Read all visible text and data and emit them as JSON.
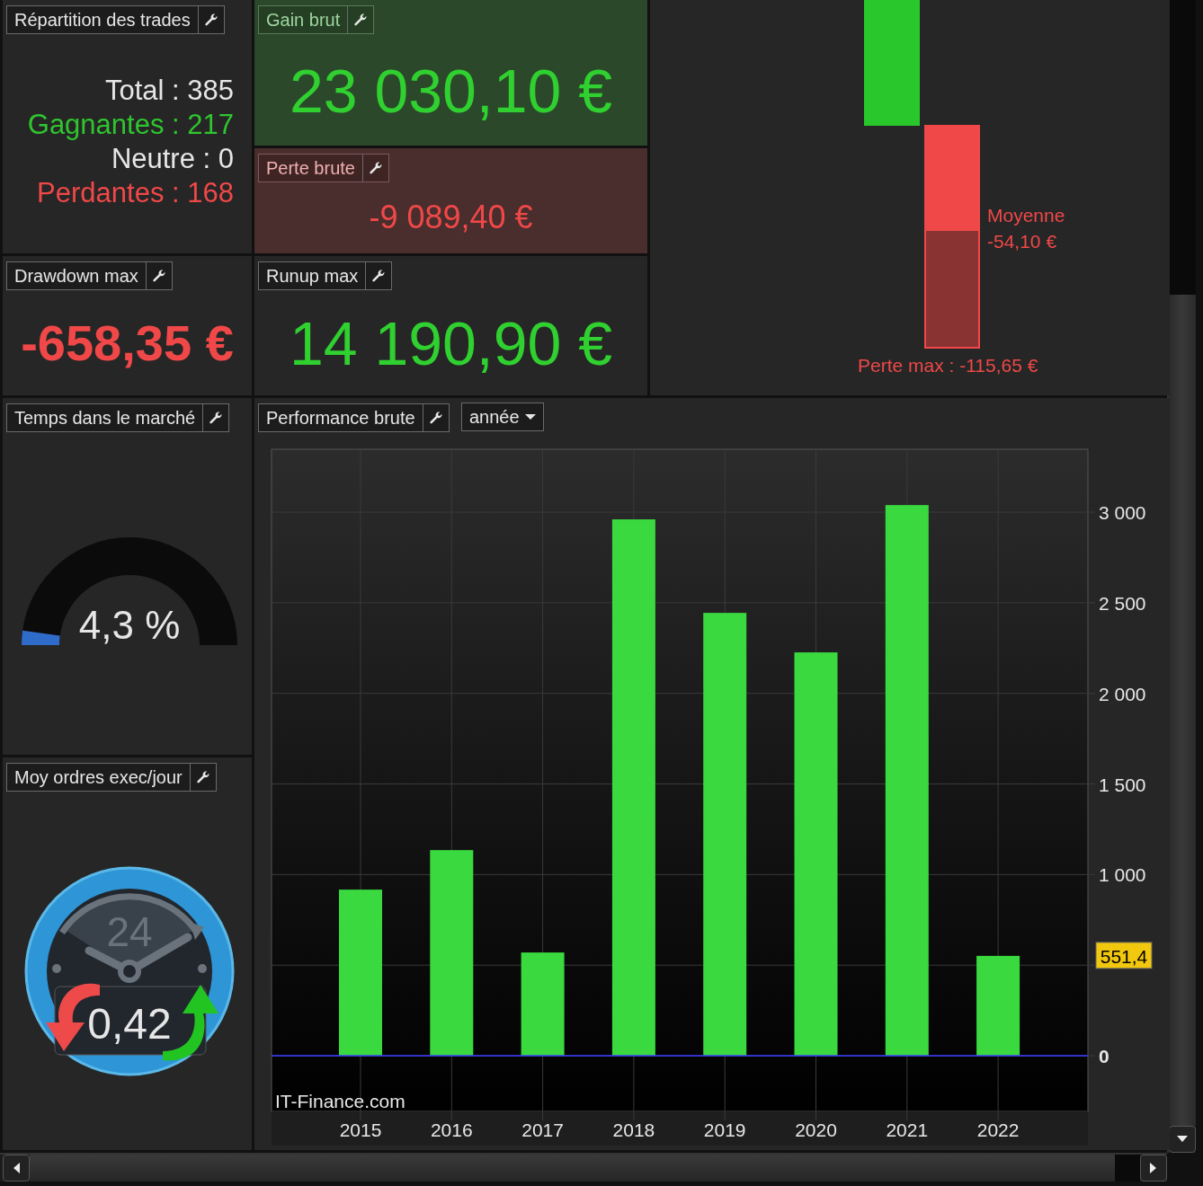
{
  "repartition": {
    "title": "Répartition des trades",
    "lines": [
      {
        "kind": "total",
        "text": "Total : 385"
      },
      {
        "kind": "win",
        "text": "Gagnantes : 217"
      },
      {
        "kind": "neutral",
        "text": "Neutre : 0"
      },
      {
        "kind": "loss",
        "text": "Perdantes : 168"
      }
    ]
  },
  "gain_brut": {
    "title": "Gain brut",
    "value": "23 030,10 €"
  },
  "perte_brute": {
    "title": "Perte brute",
    "value": "-9 089,40 €"
  },
  "drawdown_max": {
    "title": "Drawdown max",
    "value": "-658,35 €"
  },
  "runup_max": {
    "title": "Runup max",
    "value": "14 190,90 €"
  },
  "distribution": {
    "average_label": "Moyenne",
    "average_value": "-54,10 €",
    "max_loss": "Perte max : -115,65 €"
  },
  "temps_marche": {
    "title": "Temps dans le marché",
    "value": "4,3 %",
    "level": 0.043
  },
  "moy_ordres": {
    "title": "Moy ordres exec/jour",
    "clock_label": "24",
    "value": "0,42"
  },
  "performance": {
    "title": "Performance brute",
    "period": "année",
    "watermark": "IT-Finance.com",
    "marker": "551,4",
    "chart_data": {
      "type": "bar",
      "categories": [
        "2015",
        "2016",
        "2017",
        "2018",
        "2019",
        "2020",
        "2021",
        "2022"
      ],
      "series": [
        {
          "color": "#39d93f",
          "values": [
            917,
            1135,
            570,
            2960,
            2444,
            2226,
            3039,
            551.4
          ]
        }
      ],
      "grid": true,
      "ref_lines": [
        {
          "value": 0,
          "axis": "y",
          "color": "#3a3aff"
        }
      ],
      "ylim": [
        -307,
        3347
      ],
      "yticks": [
        0,
        1000,
        1500,
        2000,
        2500,
        3000
      ]
    }
  }
}
